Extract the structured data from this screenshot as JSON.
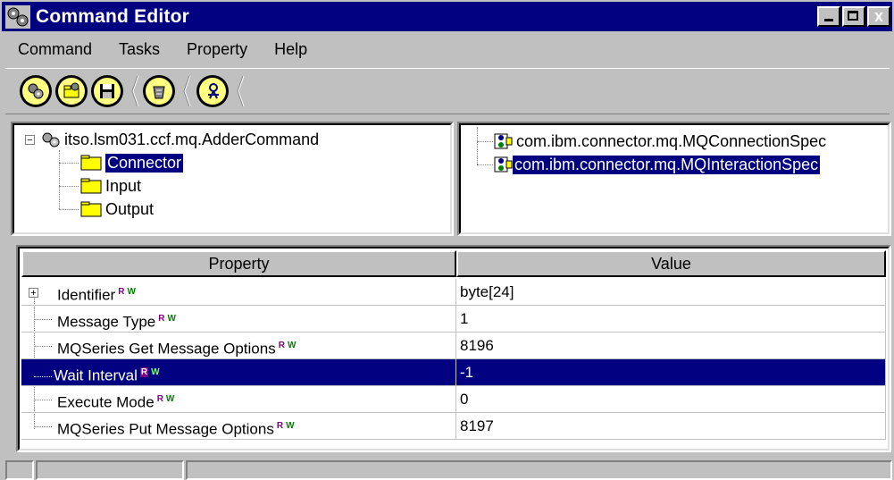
{
  "window": {
    "title": "Command Editor",
    "icon": "command-editor-icon",
    "close_glyph": "x"
  },
  "menu": [
    {
      "label": "Command"
    },
    {
      "label": "Tasks"
    },
    {
      "label": "Property"
    },
    {
      "label": "Help"
    }
  ],
  "toolbar": {
    "buttons": [
      {
        "icon": "gear-icon"
      },
      {
        "icon": "open-folder-icon"
      },
      {
        "icon": "save-disk-icon"
      },
      {
        "icon": "recycle-icon"
      },
      {
        "icon": "run-icon"
      }
    ]
  },
  "tree": {
    "root": "itso.lsm031.ccf.mq.AdderCommand",
    "root_expander": "−",
    "children": [
      {
        "label": "Connector",
        "selected": true
      },
      {
        "label": "Input",
        "selected": false
      },
      {
        "label": "Output",
        "selected": false
      }
    ]
  },
  "specs": [
    {
      "label": "com.ibm.connector.mq.MQConnectionSpec",
      "selected": false
    },
    {
      "label": "com.ibm.connector.mq.MQInteractionSpec",
      "selected": true
    }
  ],
  "table": {
    "headers": {
      "property": "Property",
      "value": "Value"
    },
    "rw_r": "R",
    "rw_w": "W",
    "row_expander": "+",
    "rows": [
      {
        "property": "Identifier",
        "value": "byte[24]",
        "selected": false
      },
      {
        "property": "Message Type",
        "value": "1",
        "selected": false
      },
      {
        "property": "MQSeries Get Message Options",
        "value": "8196",
        "selected": false
      },
      {
        "property": "Wait Interval",
        "value": "-1",
        "selected": true
      },
      {
        "property": "Execute Mode",
        "value": "0",
        "selected": false
      },
      {
        "property": "MQSeries Put Message Options",
        "value": "8197",
        "selected": false
      }
    ]
  },
  "colors": {
    "selection": "#000080",
    "window_bg": "#c0c0c0"
  }
}
